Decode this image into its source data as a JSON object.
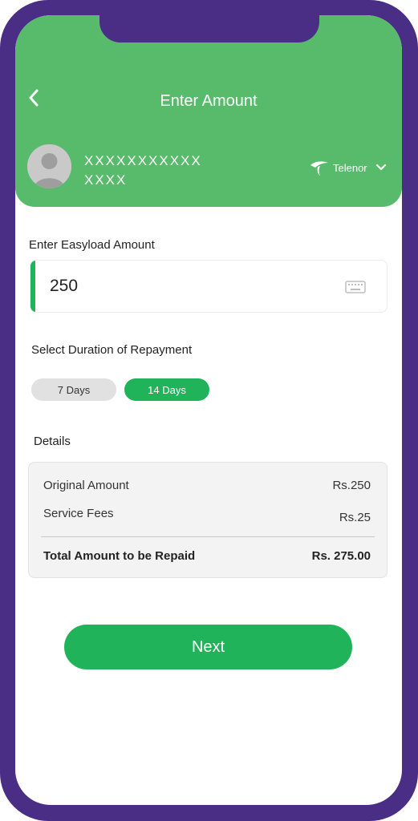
{
  "header": {
    "title": "Enter Amount",
    "user_name_line1": "XXXXXXXXXXX",
    "user_name_line2": "XXXX",
    "operator": "Telenor"
  },
  "amount": {
    "label": "Enter Easyload Amount",
    "value": "250"
  },
  "duration": {
    "label": "Select Duration of Repayment",
    "options": [
      {
        "label": "7 Days",
        "selected": false
      },
      {
        "label": "14 Days",
        "selected": true
      }
    ]
  },
  "details": {
    "label": "Details",
    "rows": [
      {
        "name": "Original Amount",
        "value": "Rs.250"
      },
      {
        "name": "Service Fees",
        "value": "Rs.25"
      }
    ],
    "total": {
      "name": "Total Amount to be Repaid",
      "value": "Rs. 275.00"
    }
  },
  "actions": {
    "next_label": "Next"
  },
  "colors": {
    "frame": "#4a2d85",
    "header": "#57bb6b",
    "accent": "#21b35a"
  }
}
